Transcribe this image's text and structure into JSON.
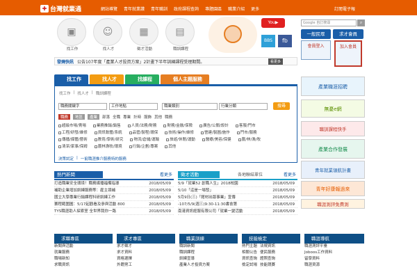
{
  "header": {
    "logo": "台灣就業通",
    "subscribe": "訂閱電子報",
    "nav": [
      "網站導覽",
      "青年就業讚",
      "青年職訓",
      "政府課程查詢",
      "專題園區",
      "職業介紹",
      "更多"
    ]
  },
  "hero": {
    "items": [
      {
        "label": "找工作",
        "icon": "briefcase-icon"
      },
      {
        "label": "找人才",
        "icon": "person-icon"
      },
      {
        "label": "徵才活動",
        "icon": "calendar-icon"
      },
      {
        "label": "職訓課程",
        "icon": "book-icon"
      }
    ]
  },
  "search": {
    "brand": "Google",
    "placeholder": "自訂搜尋"
  },
  "member": {
    "general": "一般民眾",
    "employer": "求才會員",
    "login": "會員登入",
    "join": "加入會員"
  },
  "news": {
    "tag": "發燒快訊",
    "text": "公告107年度「產業人才投資方案」2計畫下半年訓練課程受理期間。",
    "more": "看更多"
  },
  "tabs": [
    "找工作",
    "找人才",
    "找課程",
    "個人主題服務"
  ],
  "form": {
    "keyword": "職務關鍵字",
    "area": "工作地點",
    "category": "職業類別",
    "industry": "行業分類",
    "go": "搜尋",
    "filters": [
      "職務",
      "地區",
      "產業"
    ],
    "quick": [
      "部落",
      "全職",
      "專業",
      "計時",
      "服飾",
      "其他",
      "職務"
    ],
    "checks": [
      [
        "超級市場/賣場",
        "業務推銷/銷售",
        "人資/法務/財務",
        "財務/金融/保險",
        "廣告/公關/設計",
        "客服/門市"
      ],
      [
        "工程/研發/維修",
        "資訊軟體/系統",
        "品管/製程/環保",
        "技術/操作/維修",
        "營建/製圖/施作",
        "門市/服務"
      ],
      [
        "傳播/媒體/藝術",
        "教育/學術/研究",
        "物流/倉儲/運輸",
        "旅遊/休閒/運動",
        "醫療/美容/保健",
        "農/林/漁/牧"
      ],
      [
        "清潔/家事/保姆",
        "農林漁牧/環境",
        "行銷/企劃/專案",
        "其他"
      ]
    ],
    "decision": "決策試定",
    "tip": "一窮職涯推介服務特約服務",
    "sep": "|"
  },
  "hot": {
    "title": "熱門新聞",
    "more": "看更多",
    "rows": [
      {
        "t": "打造職業安全環境！職務媒播福備指導",
        "d": "2018/05/09"
      },
      {
        "t": "補助企業增加訓練服務等：雇主領補",
        "d": "2018/05/09"
      },
      {
        "t": "國立大學專業行銷課程科研訓練工作",
        "d": "2018/05/09"
      },
      {
        "t": "賽程範圍圖：5/17起觀看及參與活動 800",
        "d": "2018/05/09"
      },
      {
        "t": "TYS職涯助人探索室 全世界我你一路",
        "d": "2018/05/09"
      }
    ]
  },
  "events": {
    "title": "徵才活動",
    "sub": "各地聯結單位",
    "more": "看更多",
    "rows": [
      {
        "t": "5/9「就業52 創職人生」2018校園",
        "d": "2018/05/09"
      },
      {
        "t": "5/10「這是一場發」",
        "d": "2018/05/09"
      },
      {
        "t": "5月9日(三)「館材出版事業」宣傳",
        "d": "2018/05/09"
      },
      {
        "t": "-107/5/9(週三)9:30-11:30書會第",
        "d": "2018/05/09"
      },
      {
        "t": "南港資訊經服有限公司「就業一變活動",
        "d": "2018/05/09"
      }
    ]
  },
  "ads": [
    "產業職涯招聘",
    "無憂e網",
    "職訓課程快手",
    "產業合作發展",
    "青年就業領航計畫",
    "青年好康報過來",
    "職涯測評免費測"
  ],
  "bottom": [
    {
      "title": "求職專區",
      "items": [
        "新聞與活動",
        "就業服務",
        "職場新知",
        "求職資訊"
      ]
    },
    {
      "title": "求才專區",
      "items": [
        "求才徵才",
        "求才資料",
        "資格選擇",
        "外籍勞工"
      ]
    },
    {
      "title": "職業訓練",
      "items": [
        "職訓新聞",
        "職訓課程",
        "訓練宣導",
        "產業人才投資方案"
      ]
    },
    {
      "title": "技能檢定",
      "items": [
        "熱門主題",
        "相關公告",
        "資訊查詢",
        "檢定試場",
        "法規資訊",
        "便民服務",
        "證照查詢",
        "技能競賽"
      ]
    },
    {
      "title": "職涯導航",
      "items": [
        "職涯測評平臺",
        "Joboos工作資料",
        "留學資料",
        "職涯資源"
      ]
    }
  ]
}
